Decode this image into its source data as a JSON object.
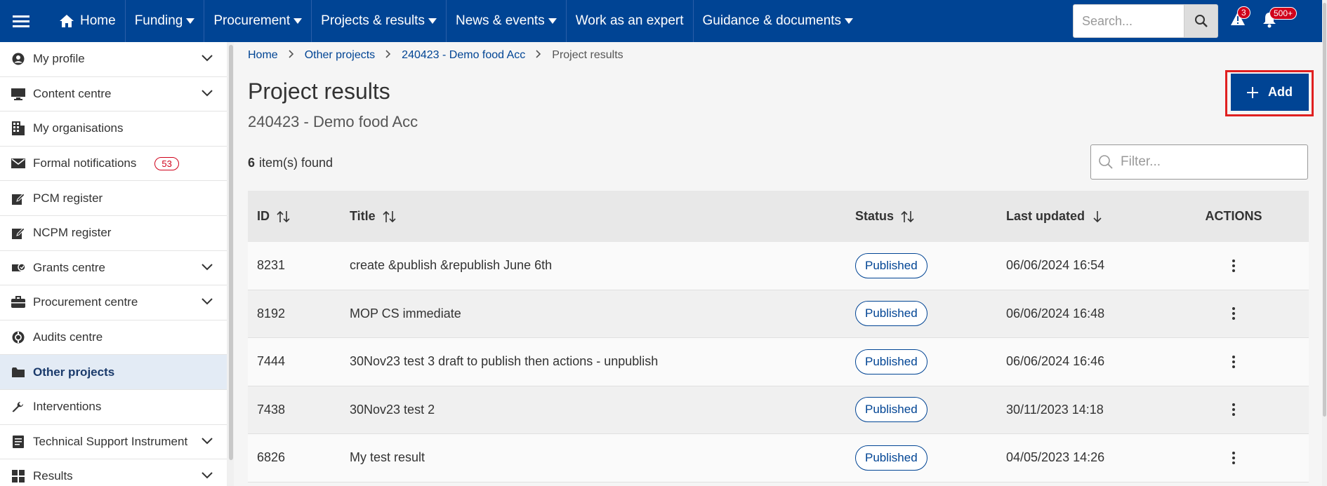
{
  "topnav": {
    "items": [
      {
        "label": "Home"
      },
      {
        "label": "Funding"
      },
      {
        "label": "Procurement"
      },
      {
        "label": "Projects & results"
      },
      {
        "label": "News & events"
      },
      {
        "label": "Work as an expert"
      },
      {
        "label": "Guidance & documents"
      }
    ],
    "search_placeholder": "Search...",
    "alerts_count": "3",
    "notifications_count": "500+"
  },
  "sidebar": {
    "items": [
      {
        "label": "My profile",
        "icon": "user-circle-icon",
        "expandable": true
      },
      {
        "label": "Content centre",
        "icon": "monitor-icon",
        "expandable": true
      },
      {
        "label": "My organisations",
        "icon": "building-icon",
        "expandable": false
      },
      {
        "label": "Formal notifications",
        "icon": "envelope-icon",
        "badge": "53"
      },
      {
        "label": "PCM register",
        "icon": "edit-icon",
        "expandable": false
      },
      {
        "label": "NCPM register",
        "icon": "edit-icon",
        "expandable": false
      },
      {
        "label": "Grants centre",
        "icon": "grants-icon",
        "expandable": true
      },
      {
        "label": "Procurement centre",
        "icon": "briefcase-icon",
        "expandable": true
      },
      {
        "label": "Audits centre",
        "icon": "audit-icon",
        "expandable": false
      },
      {
        "label": "Other projects",
        "icon": "folder-icon",
        "active": true
      },
      {
        "label": "Interventions",
        "icon": "wrench-icon",
        "expandable": false
      },
      {
        "label": "Technical Support Instrument",
        "icon": "document-icon",
        "expandable": true
      },
      {
        "label": "Results",
        "icon": "grid-icon",
        "expandable": true
      }
    ]
  },
  "breadcrumb": {
    "items": [
      "Home",
      "Other projects",
      "240423 - Demo food Acc"
    ],
    "current": "Project results"
  },
  "page": {
    "title": "Project results",
    "subtitle": "240423 - Demo food Acc",
    "count": "6",
    "count_label": "item(s) found",
    "add_label": "Add",
    "filter_placeholder": "Filter..."
  },
  "table": {
    "headers": {
      "id": "ID",
      "title": "Title",
      "status": "Status",
      "updated": "Last updated",
      "actions": "ACTIONS"
    },
    "rows": [
      {
        "id": "8231",
        "title": "create &publish &republish June 6th",
        "status": "Published",
        "updated": "06/06/2024 16:54"
      },
      {
        "id": "8192",
        "title": "MOP CS immediate",
        "status": "Published",
        "updated": "06/06/2024 16:48"
      },
      {
        "id": "7444",
        "title": "30Nov23 test 3 draft to publish then actions - unpublish",
        "status": "Published",
        "updated": "06/06/2024 16:46"
      },
      {
        "id": "7438",
        "title": "30Nov23 test 2",
        "status": "Published",
        "updated": "30/11/2023 14:18"
      },
      {
        "id": "6826",
        "title": "My test result",
        "status": "Published",
        "updated": "04/05/2023 14:26"
      }
    ]
  },
  "colors": {
    "brand": "#004494",
    "alert": "#d0021b",
    "highlight_frame": "#e02020"
  }
}
